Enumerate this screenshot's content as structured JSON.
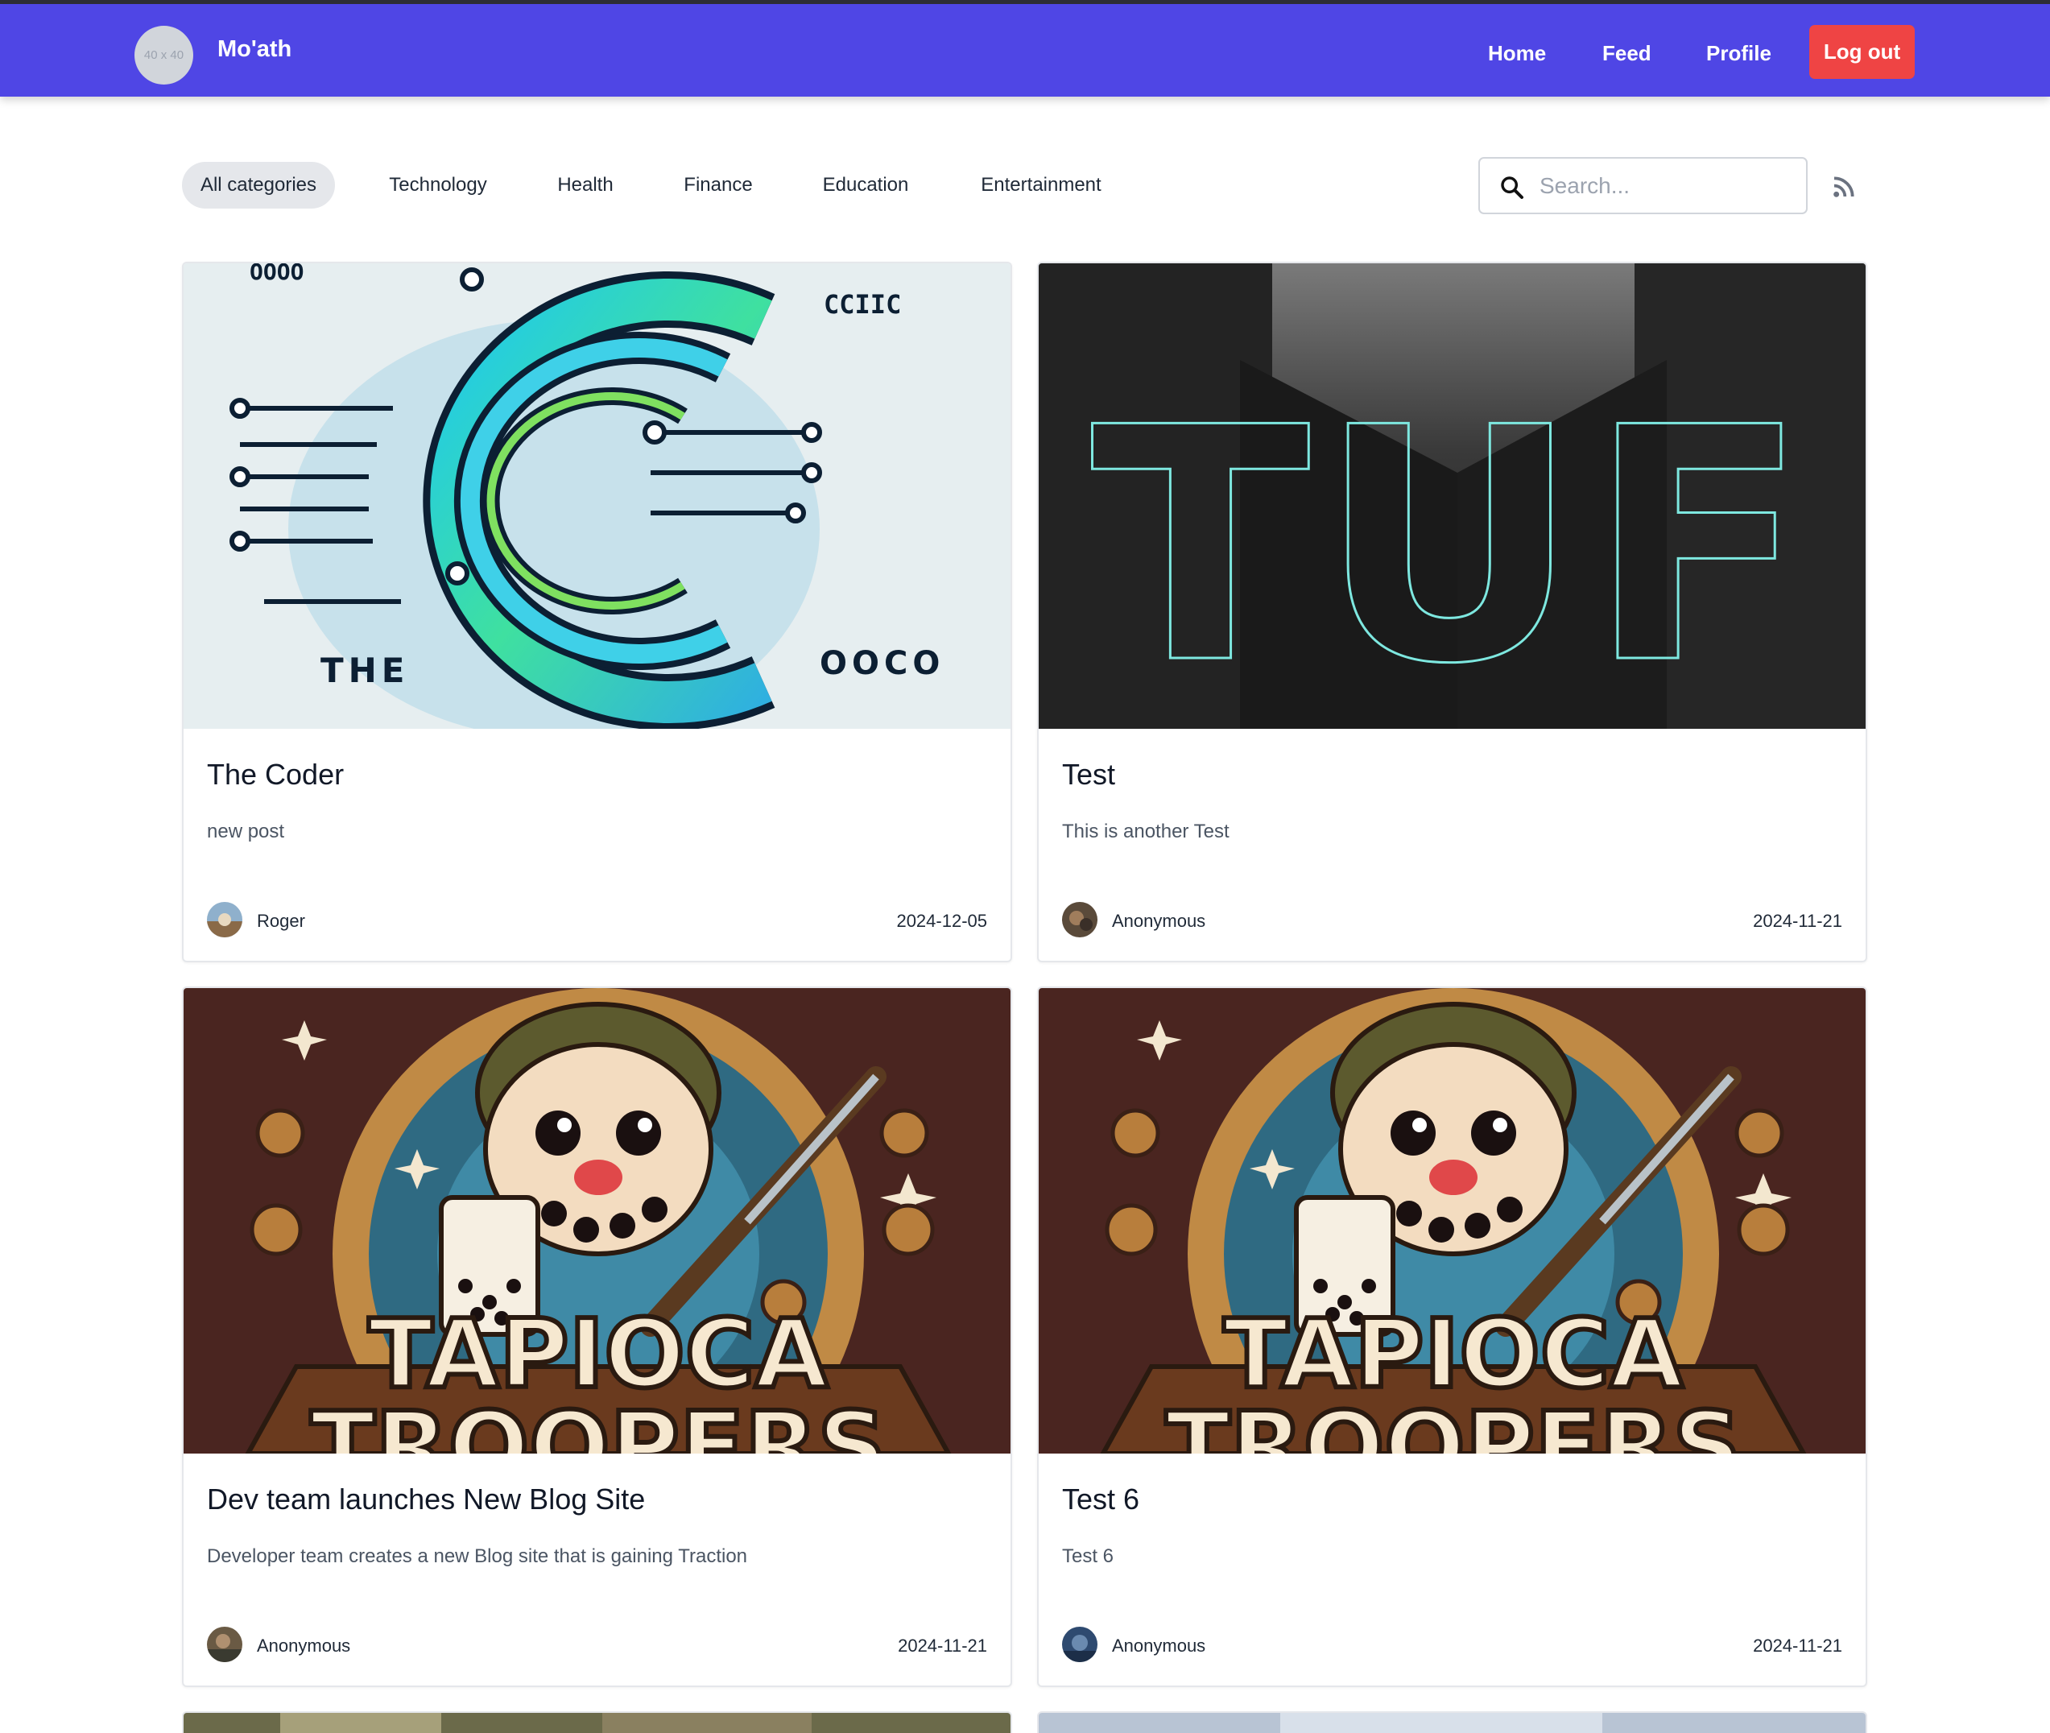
{
  "navbar": {
    "avatar_placeholder": "40 x 40",
    "brand": "Mo'ath",
    "links": [
      "Home",
      "Feed",
      "Profile"
    ],
    "logout": "Log out"
  },
  "filters": {
    "categories": [
      "All categories",
      "Technology",
      "Health",
      "Finance",
      "Education",
      "Entertainment"
    ],
    "active": "All categories"
  },
  "search": {
    "placeholder": "Search..."
  },
  "posts": [
    {
      "title": "The Coder",
      "description": "new post",
      "author": "Roger",
      "date": "2024-12-05",
      "image_text": {
        "corner_top_right": "CCIIC",
        "bottom_left": "THE",
        "bottom_right": "OOCO",
        "top_left": "OOOO"
      }
    },
    {
      "title": "Test",
      "description": "This is another Test",
      "author": "Anonymous",
      "date": "2024-11-21",
      "image_text": {
        "main": "TUF"
      }
    },
    {
      "title": "Dev team launches New Blog Site",
      "description": "Developer team creates a new Blog site that is gaining Traction",
      "author": "Anonymous",
      "date": "2024-11-21",
      "image_text": {
        "line1": "TAPIOCA",
        "line2": "TROOPERS"
      }
    },
    {
      "title": "Test 6",
      "description": "Test 6",
      "author": "Anonymous",
      "date": "2024-11-21",
      "image_text": {
        "line1": "TAPIOCA",
        "line2": "TROOPERS"
      }
    }
  ],
  "colors": {
    "navbar": "#4f46e5",
    "logout": "#ef4444",
    "active_category": "#e5e7eb"
  },
  "icons": [
    "search-icon",
    "rss-icon"
  ]
}
